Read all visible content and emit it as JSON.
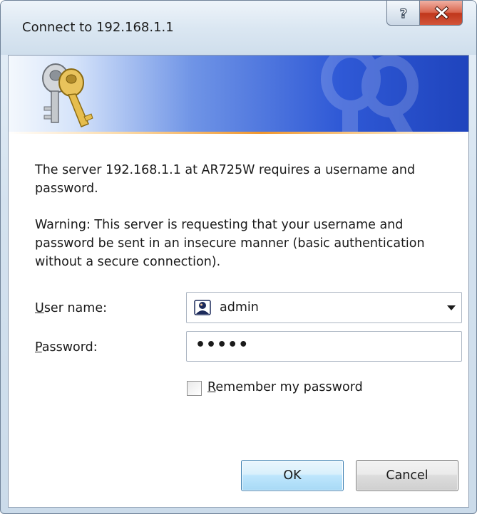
{
  "window": {
    "title": "Connect to 192.168.1.1",
    "help_button_icon": "help-icon",
    "close_button_icon": "close-icon"
  },
  "banner": {
    "icon": "keys-icon",
    "watermark_icon": "keys-watermark-icon"
  },
  "message": {
    "server_line": "The server 192.168.1.1 at AR725W requires a username and password.",
    "warning_line": "Warning: This server is requesting that your username and password be sent in an insecure manner (basic authentication without a secure connection)."
  },
  "form": {
    "username_label_accel": "U",
    "username_label_rest": "ser name:",
    "username_value": "admin",
    "username_icon": "user-icon",
    "password_label_accel": "P",
    "password_label_rest": "assword:",
    "password_value": "•••••",
    "remember_label_accel": "R",
    "remember_label_rest": "emember my password",
    "remember_checked": false
  },
  "buttons": {
    "ok_label": "OK",
    "cancel_label": "Cancel"
  },
  "colors": {
    "banner_start": "#f4f8fd",
    "banner_end": "#1f44bd",
    "accent_line": "#f0962c",
    "ok_border": "#3c7fb1",
    "close_button": "#c0361b"
  }
}
